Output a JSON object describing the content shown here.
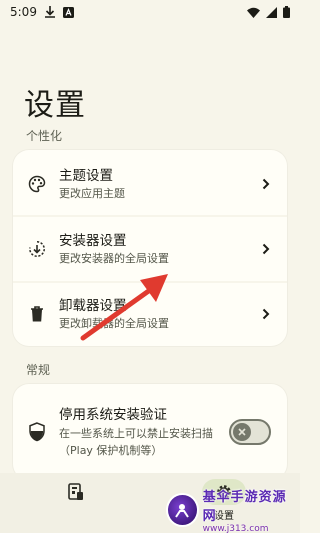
{
  "status_bar": {
    "time": "5:09"
  },
  "page_title": "设置",
  "sections": {
    "personalization": {
      "label": "个性化",
      "items": [
        {
          "title": "主题设置",
          "subtitle": "更改应用主题",
          "icon": "palette-icon"
        },
        {
          "title": "安装器设置",
          "subtitle": "更改安装器的全局设置",
          "icon": "install-icon"
        },
        {
          "title": "卸载器设置",
          "subtitle": "更改卸载器的全局设置",
          "icon": "trash-icon"
        }
      ]
    },
    "general": {
      "label": "常规",
      "items": [
        {
          "title": "停用系统安装验证",
          "subtitle": "在一些系统上可以禁止安装扫描（Play 保护机制等）",
          "icon": "shield-icon",
          "toggle": false
        }
      ]
    }
  },
  "bottom_nav": {
    "items": [
      {
        "label": "",
        "icon": "apps-icon",
        "active": false
      },
      {
        "label": "设置",
        "icon": "settings-icon",
        "active": true
      }
    ]
  },
  "watermark": {
    "title": "基伞手游资源网",
    "url": "www.j313.com"
  },
  "colors": {
    "background": "#f7f5ea",
    "card": "#fffef7",
    "arrow": "#e03a2f",
    "accent": "#dfe7c7"
  }
}
